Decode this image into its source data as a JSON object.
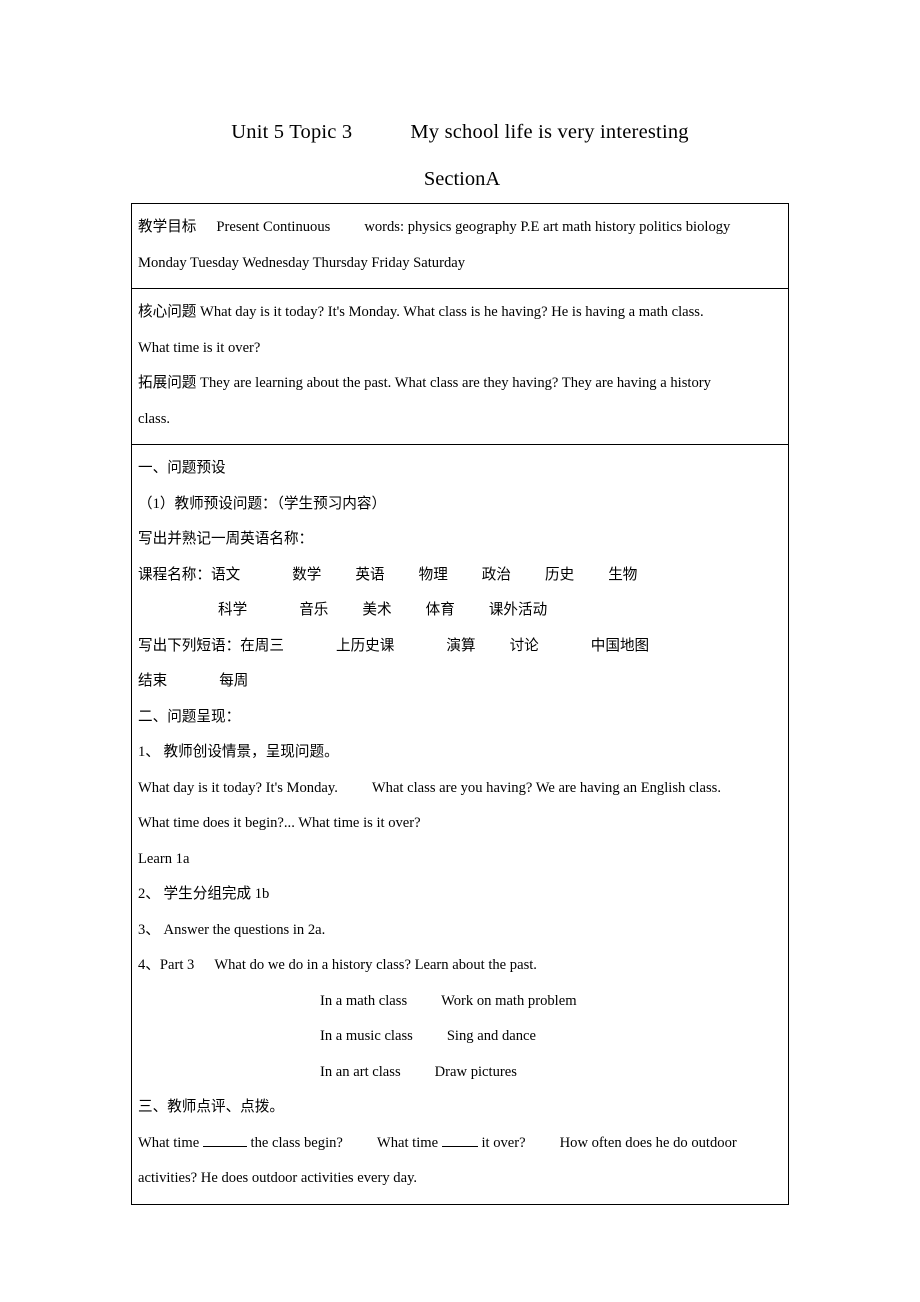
{
  "document": {
    "title_line1_unit": "Unit 5 Topic 3",
    "title_line1_topic": "My school life is very interesting",
    "title_line2": "SectionA"
  },
  "table": {
    "objectives": {
      "label": "教学目标",
      "grammar": "Present Continuous",
      "words_label": "words:",
      "words": "physics geography P.E art math history politics biology",
      "days": "Monday Tuesday Wednesday Thursday Friday Saturday"
    },
    "questions": {
      "core_label": "核心问题",
      "core_line1": "What day is it today? It's Monday. What class is he having? He is having a math class.",
      "core_line2": "What time is it over?",
      "extend_label": "拓展问题",
      "extend_line1": "They are learning about the past. What class are they having? They are having a history",
      "extend_line2": "class."
    },
    "body": {
      "section1_heading": "一、问题预设",
      "item1": "（1）教师预设问题：（学生预习内容）",
      "item2": "写出并熟记一周英语名称：",
      "courses_label": "课程名称：",
      "courses_row1": [
        "语文",
        "数学",
        "英语",
        "物理",
        "政治",
        "历史",
        "生物"
      ],
      "courses_row2": [
        "科学",
        "音乐",
        "美术",
        "体育",
        "课外活动"
      ],
      "phrases_label": "写出下列短语：",
      "phrases_row1": [
        "在周三",
        "上历史课",
        "演算",
        "讨论",
        "中国地图"
      ],
      "phrases_row2": [
        "结束",
        "每周"
      ],
      "section2_heading": "二、问题呈现：",
      "step1": "1、 教师创设情景，呈现问题。",
      "step1_en_a": "What day is it today? It's Monday.",
      "step1_en_b": "What class are you having? We are having an English class.",
      "step1_en_c": "What time does it begin?... What time is it over?",
      "learn": "Learn 1a",
      "step2": "2、 学生分组完成 1b",
      "step3": "3、 Answer the questions in 2a.",
      "step4": "4、Part 3",
      "step4_text": "What do we do in a history class? Learn about the past.",
      "class_pairs": [
        {
          "left": "In a math class",
          "right": "Work on math problem"
        },
        {
          "left": "In a music class",
          "right": "Sing and dance"
        },
        {
          "left": "In an art class",
          "right": "Draw pictures"
        }
      ],
      "section3_heading": "三、教师点评、点拨。",
      "review_a": "What time",
      "review_b": "the class begin?",
      "review_c": "What time",
      "review_d": "it over?",
      "review_e": "How often does he do outdoor",
      "review_f": "activities? He does outdoor activities every day."
    }
  }
}
